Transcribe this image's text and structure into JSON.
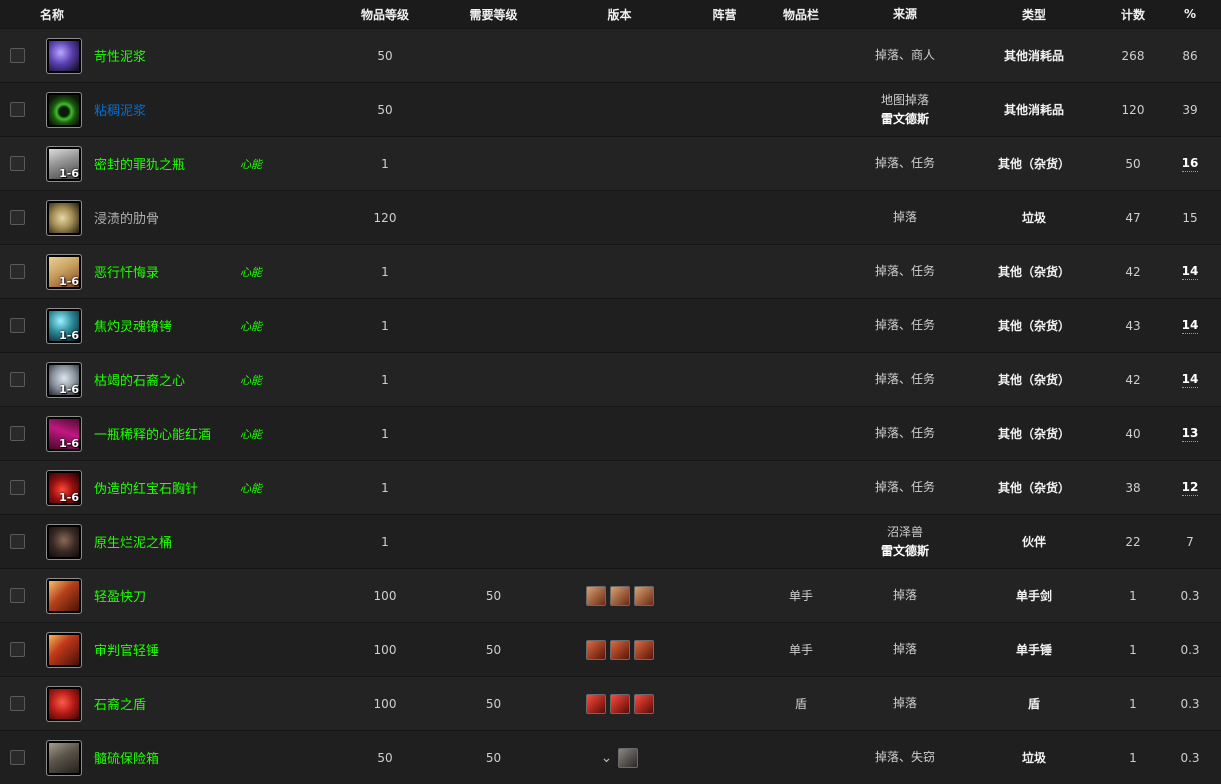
{
  "headers": {
    "name": "名称",
    "item_level": "物品等级",
    "req_level": "需要等级",
    "version": "版本",
    "faction": "阵营",
    "slot": "物品栏",
    "source": "来源",
    "type": "类型",
    "count": "计数",
    "percent": "%"
  },
  "colors": {
    "quality_green": "#1eff00",
    "quality_blue": "#0070dd",
    "quality_gray": "#b0b0b0",
    "background": "#1b1b1b"
  },
  "rows": [
    {
      "icon": "purple-crystal-icon",
      "qty": "",
      "name": "苛性泥浆",
      "quality": "green",
      "tag": "",
      "il": "50",
      "rl": "",
      "version_icons": 0,
      "version_chevron": false,
      "slot": "",
      "source": "掉落、商人",
      "source_sub": "",
      "type": "其他消耗品",
      "count": "268",
      "pct": "86",
      "pct_link": false
    },
    {
      "icon": "green-ring-icon",
      "qty": "",
      "name": "粘稠泥浆",
      "quality": "blue",
      "tag": "",
      "il": "50",
      "rl": "",
      "version_icons": 0,
      "version_chevron": false,
      "slot": "",
      "source": "地图掉落",
      "source_sub": "雷文德斯",
      "type": "其他消耗品",
      "count": "120",
      "pct": "39",
      "pct_link": false
    },
    {
      "icon": "sealed-flask-icon",
      "qty": "1-6",
      "name": "密封的罪犰之瓶",
      "quality": "green",
      "tag": "心能",
      "il": "1",
      "rl": "",
      "version_icons": 0,
      "version_chevron": false,
      "slot": "",
      "source": "掉落、任务",
      "source_sub": "",
      "type": "其他（杂货）",
      "count": "50",
      "pct": "16",
      "pct_link": true
    },
    {
      "icon": "rib-bone-icon",
      "qty": "",
      "name": "浸渍的肋骨",
      "quality": "gray",
      "tag": "",
      "il": "120",
      "rl": "",
      "version_icons": 0,
      "version_chevron": false,
      "slot": "",
      "source": "掉落",
      "source_sub": "",
      "type": "垃圾",
      "count": "47",
      "pct": "15",
      "pct_link": false
    },
    {
      "icon": "scroll-icon",
      "qty": "1-6",
      "name": "恶行忏悔录",
      "quality": "green",
      "tag": "心能",
      "il": "1",
      "rl": "",
      "version_icons": 0,
      "version_chevron": false,
      "slot": "",
      "source": "掉落、任务",
      "source_sub": "",
      "type": "其他（杂货）",
      "count": "42",
      "pct": "14",
      "pct_link": true
    },
    {
      "icon": "soul-shackle-icon",
      "qty": "1-6",
      "name": "焦灼灵魂镣铐",
      "quality": "green",
      "tag": "心能",
      "il": "1",
      "rl": "",
      "version_icons": 0,
      "version_chevron": false,
      "slot": "",
      "source": "掉落、任务",
      "source_sub": "",
      "type": "其他（杂货）",
      "count": "43",
      "pct": "14",
      "pct_link": true
    },
    {
      "icon": "stone-heart-icon",
      "qty": "1-6",
      "name": "枯竭的石裔之心",
      "quality": "green",
      "tag": "心能",
      "il": "1",
      "rl": "",
      "version_icons": 0,
      "version_chevron": false,
      "slot": "",
      "source": "掉落、任务",
      "source_sub": "",
      "type": "其他（杂货）",
      "count": "42",
      "pct": "14",
      "pct_link": true
    },
    {
      "icon": "wine-bottle-icon",
      "qty": "1-6",
      "name": "一瓶稀释的心能红酒",
      "quality": "green",
      "tag": "心能",
      "il": "1",
      "rl": "",
      "version_icons": 0,
      "version_chevron": false,
      "slot": "",
      "source": "掉落、任务",
      "source_sub": "",
      "type": "其他（杂货）",
      "count": "40",
      "pct": "13",
      "pct_link": true
    },
    {
      "icon": "ruby-brooch-icon",
      "qty": "1-6",
      "name": "伪造的红宝石胸针",
      "quality": "green",
      "tag": "心能",
      "il": "1",
      "rl": "",
      "version_icons": 0,
      "version_chevron": false,
      "slot": "",
      "source": "掉落、任务",
      "source_sub": "",
      "type": "其他（杂货）",
      "count": "38",
      "pct": "12",
      "pct_link": true
    },
    {
      "icon": "ooze-barrel-icon",
      "qty": "",
      "name": "原生烂泥之桶",
      "quality": "green",
      "tag": "",
      "il": "1",
      "rl": "",
      "version_icons": 0,
      "version_chevron": false,
      "slot": "",
      "source": "沼泽兽",
      "source_sub": "雷文德斯",
      "type": "伙伴",
      "count": "22",
      "pct": "7",
      "pct_link": false
    },
    {
      "icon": "sword-icon",
      "qty": "",
      "name": "轻盈快刀",
      "quality": "green",
      "tag": "",
      "il": "100",
      "rl": "50",
      "version_icons": 3,
      "version_chevron": false,
      "slot": "单手",
      "source": "掉落",
      "source_sub": "",
      "type": "单手剑",
      "count": "1",
      "pct": "0.3",
      "pct_link": false
    },
    {
      "icon": "mace-icon",
      "qty": "",
      "name": "审判官轻锤",
      "quality": "green",
      "tag": "",
      "il": "100",
      "rl": "50",
      "version_icons": 3,
      "version_chevron": false,
      "slot": "单手",
      "source": "掉落",
      "source_sub": "",
      "type": "单手锤",
      "count": "1",
      "pct": "0.3",
      "pct_link": false
    },
    {
      "icon": "shield-icon",
      "qty": "",
      "name": "石裔之盾",
      "quality": "green",
      "tag": "",
      "il": "100",
      "rl": "50",
      "version_icons": 3,
      "version_chevron": false,
      "slot": "盾",
      "source": "掉落",
      "source_sub": "",
      "type": "盾",
      "count": "1",
      "pct": "0.3",
      "pct_link": false
    },
    {
      "icon": "lockbox-icon",
      "qty": "",
      "name": "髓硫保险箱",
      "quality": "green",
      "tag": "",
      "il": "50",
      "rl": "50",
      "version_icons": 1,
      "version_chevron": true,
      "slot": "",
      "source": "掉落、失窃",
      "source_sub": "",
      "type": "垃圾",
      "count": "1",
      "pct": "0.3",
      "pct_link": false
    }
  ]
}
